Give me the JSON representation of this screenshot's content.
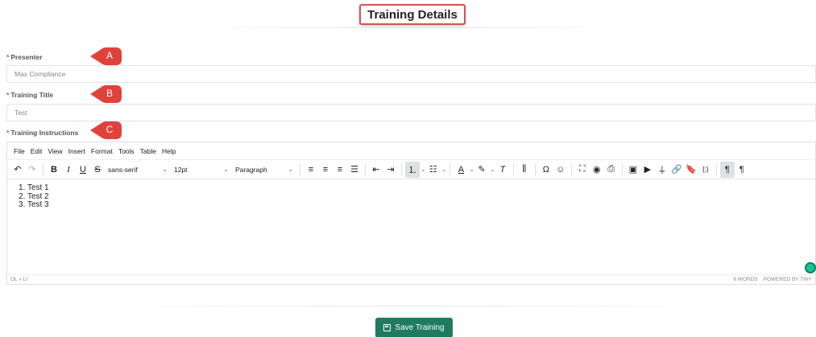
{
  "header": {
    "title": "Training Details"
  },
  "fields": {
    "presenter": {
      "label": "Presenter",
      "value": "Max Compliance"
    },
    "training_title": {
      "label": "Training Title",
      "value": "Test"
    },
    "training_instructions": {
      "label": "Training Instructions"
    }
  },
  "markers": [
    "A",
    "B",
    "C"
  ],
  "colors": {
    "marker": "#e0423b",
    "primary_button": "#1e7b5e",
    "title_border": "#d9534f"
  },
  "editor": {
    "menu": [
      "File",
      "Edit",
      "View",
      "Insert",
      "Format",
      "Tools",
      "Table",
      "Help"
    ],
    "font_family": "sans-serif",
    "font_size": "12pt",
    "block_format": "Paragraph",
    "content": [
      "1. Test 1",
      "2. Test 2",
      "3. Test 3"
    ],
    "status_path": "OL » LI",
    "word_count": "6 WORDS",
    "powered_by": "POWERED BY TINY"
  },
  "actions": {
    "save_label": "Save Training"
  }
}
